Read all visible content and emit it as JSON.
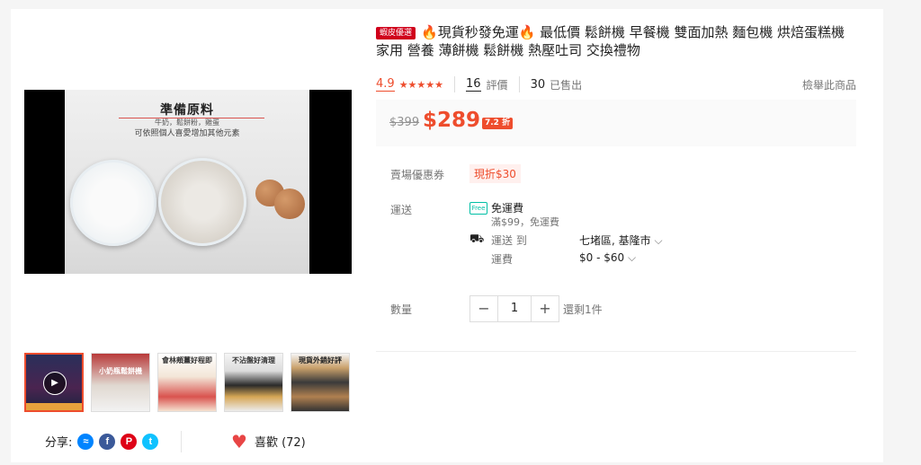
{
  "product": {
    "badge": "蝦皮優選",
    "title": "🔥現貨秒發免運🔥 最低價 鬆餅機 早餐機 雙面加熱 麵包機 烘焙蛋糕機 家用 營養 薄餅機 鬆餅機 熱壓吐司 交換禮物",
    "rating": "4.9",
    "stars": "★★★★★",
    "reviews_count": "16",
    "reviews_label": "評價",
    "sold_count": "30",
    "sold_label": "已售出",
    "report_label": "檢舉此商品"
  },
  "price": {
    "original": "$399",
    "current": "$289",
    "discount": "7.2 折"
  },
  "coupon": {
    "label": "賣場優惠券",
    "value": "現折$30"
  },
  "shipping": {
    "label": "運送",
    "free_icon": "Free",
    "free_label": "免運費",
    "free_condition": "滿$99，免運費",
    "ship_to_label": "運送 到",
    "destination": "七堵區, 基隆市",
    "fee_label": "運費",
    "fee_range": "$0 - $60"
  },
  "quantity": {
    "label": "數量",
    "value": "1",
    "minus": "−",
    "plus": "+",
    "stock": "還剩1件"
  },
  "media": {
    "video_title": "準備原料",
    "video_subtitle_1": "牛奶，鬆餅粉，雞蛋",
    "video_subtitle_2": "可依照個人喜愛增加其他元素",
    "thumbnails": [
      {
        "label": "",
        "icon": "play-icon"
      },
      {
        "label": "小奶瓶鬆餅機"
      },
      {
        "label": "會林頰薑好程即"
      },
      {
        "label": "不沾盤好清理"
      },
      {
        "label": "現貨外銷好評"
      }
    ]
  },
  "share": {
    "label": "分享:",
    "icons": [
      "messenger-icon",
      "facebook-icon",
      "pinterest-icon",
      "twitter-icon"
    ]
  },
  "like": {
    "label": "喜歡 (72)"
  },
  "colors": {
    "accent": "#ee4d2d",
    "badge": "#d0011b"
  }
}
